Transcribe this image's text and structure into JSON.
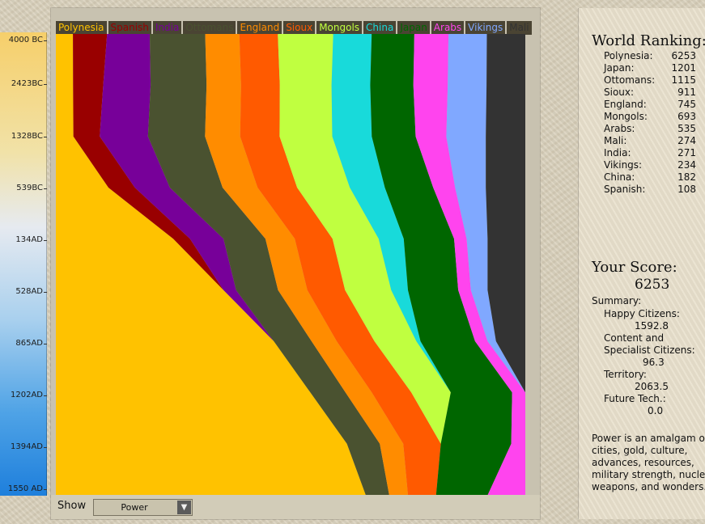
{
  "timeline": {
    "labels": [
      "4000 BC",
      "2423BC",
      "1328BC",
      "539BC",
      "134AD",
      "528AD",
      "865AD",
      "1202AD",
      "1394AD",
      "1550 AD"
    ]
  },
  "chart_data": {
    "type": "area",
    "title": "",
    "xlabel": "",
    "ylabel": "",
    "stacked": true,
    "orientation": "vertical-time",
    "grid": false,
    "legend_position": "top",
    "categories": [
      "4000 BC",
      "2423BC",
      "1328BC",
      "539BC",
      "134AD",
      "528AD",
      "865AD",
      "1202AD",
      "1394AD",
      "1550 AD"
    ],
    "series": [
      {
        "name": "Polynesia",
        "color": "#ffc200",
        "values": [
          4,
          4,
          4,
          12,
          28,
          40,
          52,
          58,
          62,
          66
        ]
      },
      {
        "name": "Spanish",
        "color": "#990000",
        "values": [
          8,
          7,
          6,
          6,
          4,
          0,
          0,
          0,
          0,
          0
        ]
      },
      {
        "name": "India",
        "color": "#770099",
        "values": [
          10,
          11,
          11,
          8,
          8,
          3,
          0,
          0,
          0,
          0
        ]
      },
      {
        "name": "Ottomans",
        "color": "#4a5230",
        "values": [
          13,
          13,
          13,
          12,
          10,
          10,
          9,
          8,
          7,
          5
        ]
      },
      {
        "name": "England",
        "color": "#ff8c00",
        "values": [
          8,
          8,
          8,
          8,
          7,
          7,
          6,
          6,
          5,
          4
        ]
      },
      {
        "name": "Sioux",
        "color": "#ff5a00",
        "values": [
          9,
          9,
          9,
          9,
          9,
          9,
          9,
          9,
          8,
          6
        ]
      },
      {
        "name": "Mongols",
        "color": "#c0ff40",
        "values": [
          13,
          12,
          12,
          12,
          11,
          11,
          10,
          9,
          0,
          0
        ]
      },
      {
        "name": "China",
        "color": "#18dada",
        "values": [
          9,
          9,
          9,
          8,
          6,
          4,
          1,
          0,
          0,
          0
        ]
      },
      {
        "name": "Japan",
        "color": "#006600",
        "values": [
          10,
          10,
          10,
          11,
          12,
          12,
          13,
          14,
          15,
          11
        ]
      },
      {
        "name": "Arabs",
        "color": "#ff44ee",
        "values": [
          8,
          8,
          7,
          5,
          3,
          3,
          3,
          3,
          3,
          8
        ]
      },
      {
        "name": "Vikings",
        "color": "#80a8ff",
        "values": [
          9,
          9,
          9,
          7,
          5,
          4,
          2,
          0,
          0,
          0
        ]
      },
      {
        "name": "Mali",
        "color": "#333333",
        "values": [
          9,
          9,
          9,
          9,
          9,
          9,
          7,
          0,
          0,
          0
        ]
      }
    ]
  },
  "controls": {
    "show_label": "Show",
    "show_value": "Power",
    "arrow_icon": "triangle-down-icon"
  },
  "ranking": {
    "title": "World Ranking:",
    "rows": [
      {
        "name": "Polynesia:",
        "score": "6253"
      },
      {
        "name": "Japan:",
        "score": "1201"
      },
      {
        "name": "Ottomans:",
        "score": "1115"
      },
      {
        "name": "Sioux:",
        "score": "911"
      },
      {
        "name": "England:",
        "score": "745"
      },
      {
        "name": "Mongols:",
        "score": "693"
      },
      {
        "name": "Arabs:",
        "score": "535"
      },
      {
        "name": "Mali:",
        "score": "274"
      },
      {
        "name": "India:",
        "score": "271"
      },
      {
        "name": "Vikings:",
        "score": "234"
      },
      {
        "name": "China:",
        "score": "182"
      },
      {
        "name": "Spanish:",
        "score": "108"
      }
    ]
  },
  "score": {
    "title": "Your Score:",
    "value": "6253",
    "summary_label": "Summary:",
    "happy_label": "Happy Citizens:",
    "happy_value": "1592.8",
    "content_label_1": "Content and",
    "content_label_2": "Specialist Citizens:",
    "content_value": "96.3",
    "territory_label": "Territory:",
    "territory_value": "2063.5",
    "future_label": "Future Tech.:",
    "future_value": "0.0",
    "description_lines": [
      "Power is an amalgam of",
      "cities, gold, culture,",
      "advances, resources,",
      "military strength, nuclear",
      "weapons, and wonders."
    ]
  }
}
